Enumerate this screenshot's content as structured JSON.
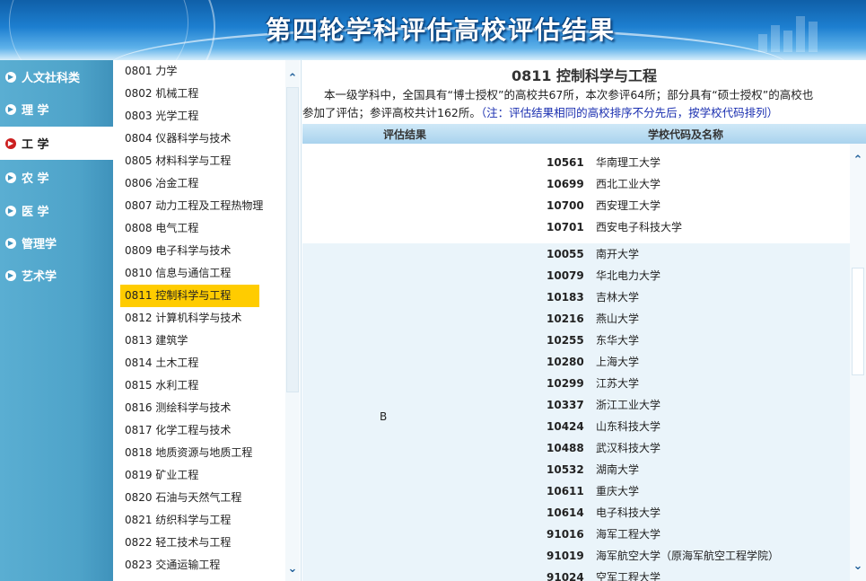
{
  "banner": {
    "title": "第四轮学科评估高校评估结果"
  },
  "categories": [
    {
      "label": "人文社科类",
      "active": false
    },
    {
      "label": "理 学",
      "active": false
    },
    {
      "label": "工 学",
      "active": true
    },
    {
      "label": "农 学",
      "active": false
    },
    {
      "label": "医 学",
      "active": false
    },
    {
      "label": "管理学",
      "active": false
    },
    {
      "label": "艺术学",
      "active": false
    }
  ],
  "subjects": [
    {
      "label": "0801 力学",
      "active": false
    },
    {
      "label": "0802 机械工程",
      "active": false
    },
    {
      "label": "0803 光学工程",
      "active": false
    },
    {
      "label": "0804 仪器科学与技术",
      "active": false
    },
    {
      "label": "0805 材料科学与工程",
      "active": false
    },
    {
      "label": "0806 冶金工程",
      "active": false
    },
    {
      "label": "0807 动力工程及工程热物理",
      "active": false
    },
    {
      "label": "0808 电气工程",
      "active": false
    },
    {
      "label": "0809 电子科学与技术",
      "active": false
    },
    {
      "label": "0810 信息与通信工程",
      "active": false
    },
    {
      "label": "0811 控制科学与工程",
      "active": true
    },
    {
      "label": "0812 计算机科学与技术",
      "active": false
    },
    {
      "label": "0813 建筑学",
      "active": false
    },
    {
      "label": "0814 土木工程",
      "active": false
    },
    {
      "label": "0815 水利工程",
      "active": false
    },
    {
      "label": "0816 测绘科学与技术",
      "active": false
    },
    {
      "label": "0817 化学工程与技术",
      "active": false
    },
    {
      "label": "0818 地质资源与地质工程",
      "active": false
    },
    {
      "label": "0819 矿业工程",
      "active": false
    },
    {
      "label": "0820 石油与天然气工程",
      "active": false
    },
    {
      "label": "0821 纺织科学与工程",
      "active": false
    },
    {
      "label": "0822 轻工技术与工程",
      "active": false
    },
    {
      "label": "0823 交通运输工程",
      "active": false
    }
  ],
  "main": {
    "title": "0811 控制科学与工程",
    "desc_line1": "本一级学科中，全国具有“博士授权”的高校共67所，本次参评64所；部分具有“硕士授权”的高校也",
    "desc_line2": "参加了评估；参评高校共计162所。",
    "desc_note": "（注：评估结果相同的高校排序不分先后，按学校代码排列）",
    "col_result": "评估结果",
    "col_school": "学校代码及名称",
    "groups": [
      {
        "grade": "",
        "style": "white",
        "rows": [
          {
            "code": "10561",
            "name": "华南理工大学"
          },
          {
            "code": "10699",
            "name": "西北工业大学"
          },
          {
            "code": "10700",
            "name": "西安理工大学"
          },
          {
            "code": "10701",
            "name": "西安电子科技大学"
          }
        ]
      },
      {
        "grade": "B",
        "style": "blue",
        "rows": [
          {
            "code": "10055",
            "name": "南开大学"
          },
          {
            "code": "10079",
            "name": "华北电力大学"
          },
          {
            "code": "10183",
            "name": "吉林大学"
          },
          {
            "code": "10216",
            "name": "燕山大学"
          },
          {
            "code": "10255",
            "name": "东华大学"
          },
          {
            "code": "10280",
            "name": "上海大学"
          },
          {
            "code": "10299",
            "name": "江苏大学"
          },
          {
            "code": "10337",
            "name": "浙江工业大学"
          },
          {
            "code": "10424",
            "name": "山东科技大学"
          },
          {
            "code": "10488",
            "name": "武汉科技大学"
          },
          {
            "code": "10532",
            "name": "湖南大学"
          },
          {
            "code": "10611",
            "name": "重庆大学"
          },
          {
            "code": "10614",
            "name": "电子科技大学"
          },
          {
            "code": "91016",
            "name": "海军工程大学"
          },
          {
            "code": "91019",
            "name": "海军航空大学（原海军航空工程学院）"
          },
          {
            "code": "91024",
            "name": "空军工程大学"
          }
        ]
      }
    ]
  },
  "icons": {
    "category_bullet": "arrow-right-circle-icon",
    "scroll_up": "chevron-up-icon",
    "scroll_down": "chevron-down-icon"
  }
}
